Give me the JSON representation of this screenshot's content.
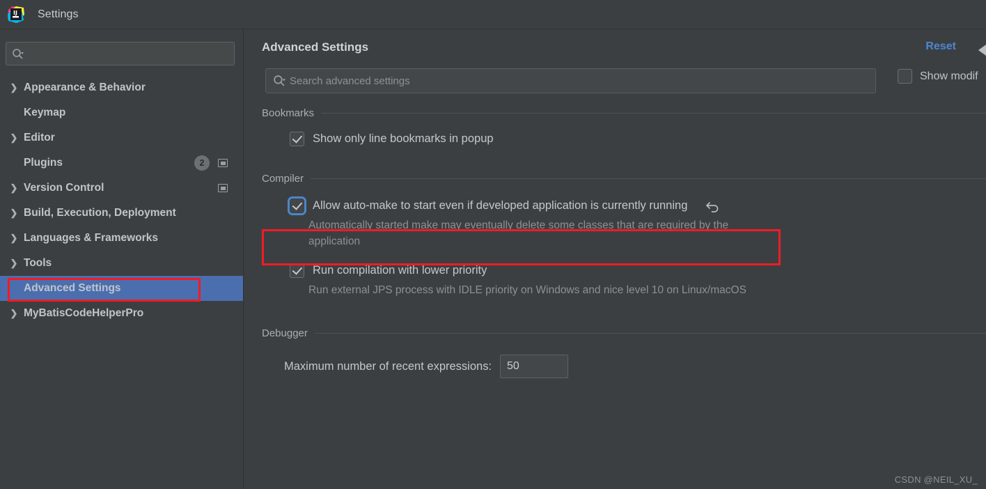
{
  "window": {
    "title": "Settings",
    "logo_icon": "intellij-idea-logo"
  },
  "sidebar": {
    "search": {
      "value": "",
      "placeholder": "",
      "icon": "search-icon"
    },
    "items": [
      {
        "label": "Appearance & Behavior",
        "expandable": true,
        "selected": false,
        "badge": null,
        "window_icon": false
      },
      {
        "label": "Keymap",
        "expandable": false,
        "selected": false,
        "badge": null,
        "window_icon": false
      },
      {
        "label": "Editor",
        "expandable": true,
        "selected": false,
        "badge": null,
        "window_icon": false
      },
      {
        "label": "Plugins",
        "expandable": false,
        "selected": false,
        "badge": "2",
        "window_icon": true
      },
      {
        "label": "Version Control",
        "expandable": true,
        "selected": false,
        "badge": null,
        "window_icon": true
      },
      {
        "label": "Build, Execution, Deployment",
        "expandable": true,
        "selected": false,
        "badge": null,
        "window_icon": false
      },
      {
        "label": "Languages & Frameworks",
        "expandable": true,
        "selected": false,
        "badge": null,
        "window_icon": false
      },
      {
        "label": "Tools",
        "expandable": true,
        "selected": false,
        "badge": null,
        "window_icon": false
      },
      {
        "label": "Advanced Settings",
        "expandable": false,
        "selected": true,
        "badge": null,
        "window_icon": false
      },
      {
        "label": "MyBatisCodeHelperPro",
        "expandable": true,
        "selected": false,
        "badge": null,
        "window_icon": false
      }
    ]
  },
  "main": {
    "title": "Advanced Settings",
    "reset_label": "Reset",
    "search": {
      "value": "",
      "placeholder": "Search advanced settings",
      "icon": "search-icon"
    },
    "show_modified": {
      "label": "Show modif",
      "checked": false
    },
    "sections": [
      {
        "title": "Bookmarks",
        "options": [
          {
            "label": "Show only line bookmarks in popup",
            "checked": true,
            "focused": false,
            "description": "",
            "revert": false
          }
        ]
      },
      {
        "title": "Compiler",
        "options": [
          {
            "label": "Allow auto-make to start even if developed application is currently running",
            "checked": true,
            "focused": true,
            "description": "Automatically started make may eventually delete some classes that are required by the application",
            "revert": true
          },
          {
            "label": "Run compilation with lower priority",
            "checked": true,
            "focused": false,
            "description": "Run external JPS process with IDLE priority on Windows and nice level 10 on Linux/macOS",
            "revert": false
          }
        ]
      },
      {
        "title": "Debugger",
        "field": {
          "label": "Maximum number of recent expressions:",
          "value": "50"
        }
      }
    ]
  },
  "watermark": "CSDN @NEIL_XU_",
  "colors": {
    "background": "#3c3f41",
    "selection_blue": "#4b6eaf",
    "link_blue": "#4d86d4",
    "annotation_red": "#f01c25",
    "text_primary": "#c3c8cd",
    "text_muted": "#8b9197"
  }
}
